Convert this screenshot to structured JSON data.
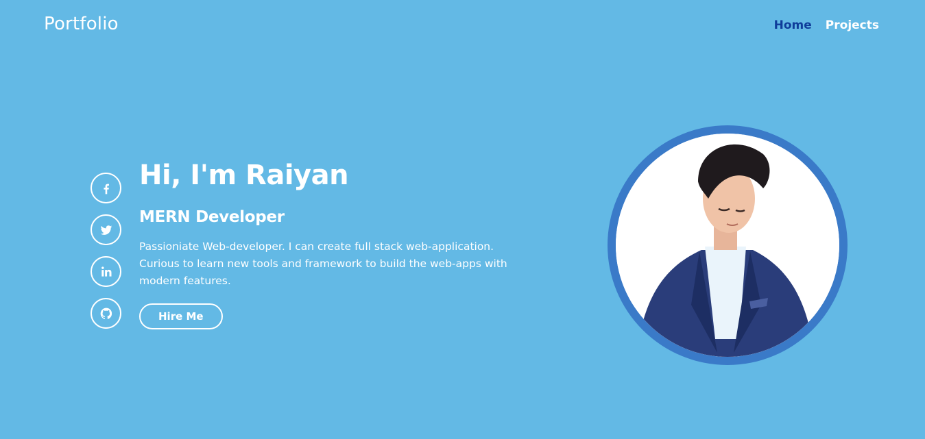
{
  "header": {
    "logo": "Portfolio",
    "nav": [
      {
        "label": "Home",
        "active": true
      },
      {
        "label": "Projects",
        "active": false
      }
    ]
  },
  "socials": [
    {
      "icon": "facebook-icon"
    },
    {
      "icon": "twitter-icon"
    },
    {
      "icon": "linkedin-icon"
    },
    {
      "icon": "github-icon"
    }
  ],
  "intro": {
    "greeting": "Hi, I'm Raiyan",
    "role": "MERN Developer",
    "description": "Passioniate Web-developer. I can create full stack web-application. Curious to learn new tools and framework to build the web-apps with modern features.",
    "cta": "Hire Me"
  },
  "colors": {
    "background": "#63b9e5",
    "active_nav": "#0f3d9a",
    "photo_ring": "#3a7ac8"
  }
}
